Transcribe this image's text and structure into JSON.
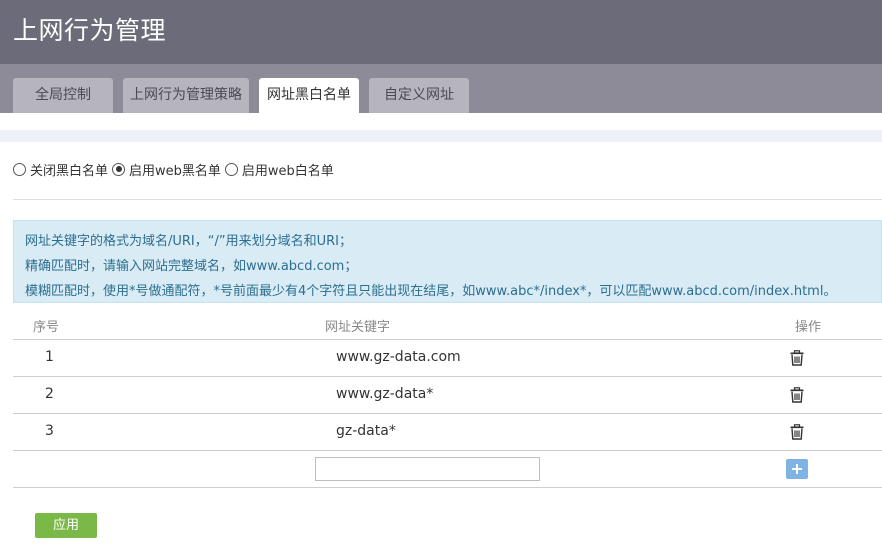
{
  "header": {
    "title": "上网行为管理"
  },
  "tabs": [
    {
      "label": "全局控制",
      "active": false
    },
    {
      "label": "上网行为管理策略",
      "active": false
    },
    {
      "label": "网址黑白名单",
      "active": true
    },
    {
      "label": "自定义网址",
      "active": false
    }
  ],
  "mode": {
    "options": [
      {
        "label": "关闭黑白名单",
        "checked": false
      },
      {
        "label": "启用web黑名单",
        "checked": true
      },
      {
        "label": "启用web白名单",
        "checked": false
      }
    ]
  },
  "notice": {
    "lines": [
      "网址关键字的格式为域名/URI，“/”用来划分域名和URI；",
      "精确匹配时，请输入网站完整域名，如www.abcd.com；",
      "模糊匹配时，使用*号做通配符，*号前面最少有4个字符且只能出现在结尾，如www.abc*/index*，可以匹配www.abcd.com/index.html。"
    ]
  },
  "table": {
    "headers": {
      "index": "序号",
      "url": "网址关键字",
      "action": "操作"
    },
    "rows": [
      {
        "index": "1",
        "url": "www.gz-data.com"
      },
      {
        "index": "2",
        "url": "www.gz-data*"
      },
      {
        "index": "3",
        "url": "gz-data*"
      }
    ],
    "new_entry": {
      "value": "",
      "placeholder": ""
    }
  },
  "actions": {
    "apply_label": "应用"
  },
  "colors": {
    "titlebar": "#6b6b7a",
    "tabbar": "#8e8b99",
    "notice_bg": "#d9ecf5",
    "notice_text": "#2c6e8f",
    "apply": "#7ab848",
    "add": "#7fb3e3"
  },
  "icons": {
    "delete": "trash-icon",
    "add": "plus-icon"
  }
}
